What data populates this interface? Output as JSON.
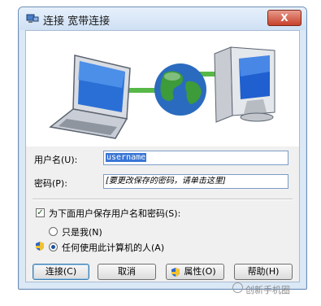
{
  "window": {
    "title": "连接 宽带连接",
    "close_symbol": "X"
  },
  "form": {
    "username_label": "用户名(U):",
    "username_value": "username",
    "password_label": "密码(P):",
    "password_value": "[要更改保存的密码，请单击这里]"
  },
  "options": {
    "save_label": "为下面用户保存用户名和密码(S):",
    "save_checked": true,
    "only_me_label": "只是我(N)",
    "anyone_label": "任何使用此计算机的人(A)",
    "selected": "anyone"
  },
  "buttons": {
    "connect": "连接(C)",
    "cancel": "取消",
    "properties": "属性(O)",
    "help": "帮助(H)"
  },
  "watermark": {
    "text": "创新手机圈"
  },
  "colors": {
    "accent": "#3a76d6",
    "close": "#c7412b",
    "frame": "#dbe8f6"
  }
}
